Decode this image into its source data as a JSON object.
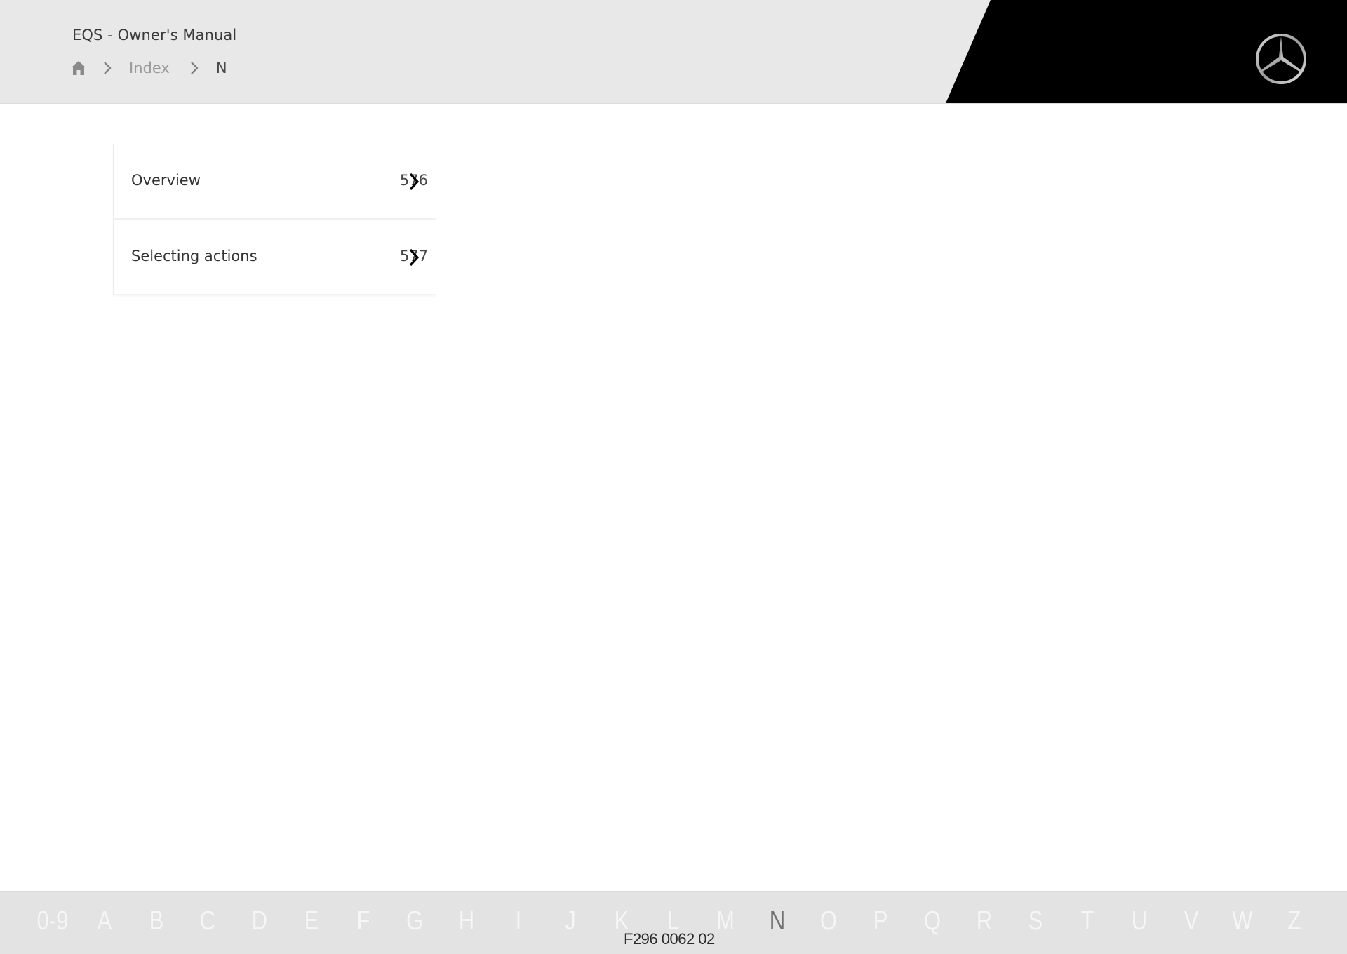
{
  "header": {
    "title": "EQS - Owner's Manual",
    "breadcrumb": {
      "home_icon": "home-icon",
      "separator_icon": "chevron-right-icon",
      "items": [
        "Index",
        "N"
      ]
    },
    "logo": "mercedes-star-logo",
    "colors": {
      "header_bg": "#e8e8e8",
      "brand_block": "#000000"
    }
  },
  "index_entries": [
    {
      "label": "Overview",
      "page": "576",
      "icon": "chevron-right-icon"
    },
    {
      "label": "Selecting actions",
      "page": "577",
      "icon": "chevron-right-icon"
    }
  ],
  "alphabet_nav": {
    "letters": [
      "0-9",
      "A",
      "B",
      "C",
      "D",
      "E",
      "F",
      "G",
      "H",
      "I",
      "J",
      "K",
      "L",
      "M",
      "N",
      "O",
      "P",
      "Q",
      "R",
      "S",
      "T",
      "U",
      "V",
      "W",
      "Z"
    ],
    "active": "N"
  },
  "image_code": "F296 0062 02"
}
